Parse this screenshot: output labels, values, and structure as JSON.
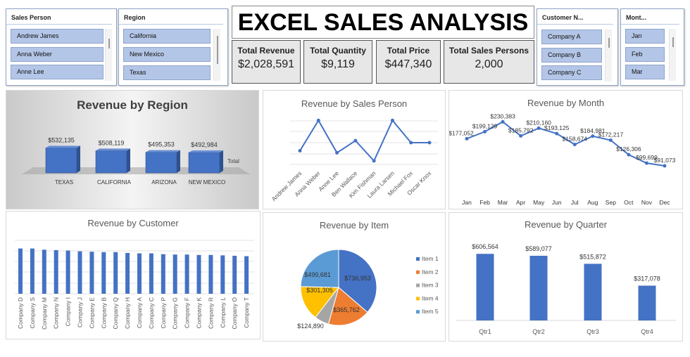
{
  "title": "EXCEL SALES ANALYSIS",
  "slicers": {
    "sales_person": {
      "header": "Sales Person",
      "items": [
        "Andrew James",
        "Anna Weber",
        "Anne Lee"
      ]
    },
    "region": {
      "header": "Region",
      "items": [
        "California",
        "New Mexico",
        "Texas"
      ]
    },
    "customer": {
      "header": "Customer N...",
      "items": [
        "Company A",
        "Company B",
        "Company C"
      ]
    },
    "month": {
      "header": "Mont...",
      "items": [
        "Jan",
        "Feb",
        "Mar"
      ]
    }
  },
  "kpis": [
    {
      "label": "Total Revenue",
      "value": "$2,028,591"
    },
    {
      "label": "Total Quantity",
      "value": "$9,119"
    },
    {
      "label": "Total Price",
      "value": "$447,340"
    },
    {
      "label": "Total Sales Persons",
      "value": "2,000"
    }
  ],
  "colors": {
    "accent": "#4472c4",
    "orange": "#ed7d31",
    "gray": "#a5a5a5",
    "yellow": "#ffc000",
    "lightblue": "#5b9bd5"
  },
  "chart_data": [
    {
      "id": "region",
      "type": "bar",
      "title": "Revenue by Region",
      "categories": [
        "TEXAS",
        "CALIFORNIA",
        "ARIZONA",
        "NEW MEXICO"
      ],
      "values": [
        532135,
        508119,
        495353,
        492984
      ],
      "labels": [
        "$532,135",
        "$508,119",
        "$495,353",
        "$492,984"
      ],
      "series_label": "Total"
    },
    {
      "id": "salesperson",
      "type": "line",
      "title": "Revenue by Sales Person",
      "categories": [
        "Andrew James",
        "Anna Weber",
        "Anne Lee",
        "Ben Wallace",
        "Kim Fishman",
        "Laura Larsen",
        "Michael Fox",
        "Oscar Knox"
      ],
      "values": [
        252000,
        282000,
        250000,
        262000,
        242000,
        282000,
        260000,
        260000
      ]
    },
    {
      "id": "month",
      "type": "line",
      "title": "Revenue by Month",
      "categories": [
        "Jan",
        "Feb",
        "Mar",
        "Apr",
        "May",
        "Jun",
        "Jul",
        "Aug",
        "Sep",
        "Oct",
        "Nov",
        "Dec"
      ],
      "values": [
        177052,
        199129,
        230383,
        185792,
        210160,
        193125,
        158674,
        184981,
        172217,
        126306,
        99699,
        91073
      ],
      "labels": [
        "$177,052",
        "$199,129",
        "$230,383",
        "$185,792",
        "$210,160",
        "$193,125",
        "$158,674",
        "$184,981",
        "$172,217",
        "$126,306",
        "$99,699",
        "$91,073"
      ]
    },
    {
      "id": "customer",
      "type": "bar",
      "title": "Revenue by Customer",
      "categories": [
        "Company D",
        "Company S",
        "Company M",
        "Company N",
        "Company I",
        "Company J",
        "Company E",
        "Company B",
        "Company Q",
        "Company H",
        "Company A",
        "Company C",
        "Company P",
        "Company G",
        "Company F",
        "Company K",
        "Company R",
        "Company L",
        "Company O",
        "Company T"
      ],
      "values": [
        112,
        112,
        109,
        108,
        107,
        105,
        104,
        103,
        103,
        101,
        100,
        100,
        98,
        97,
        97,
        96,
        96,
        95,
        94,
        93
      ],
      "ylim": [
        0,
        120
      ]
    },
    {
      "id": "item",
      "type": "pie",
      "title": "Revenue by Item",
      "categories": [
        "Item 1",
        "Item 2",
        "Item 3",
        "Item 4",
        "Item 5"
      ],
      "values": [
        736953,
        365762,
        124890,
        301305,
        499681
      ],
      "labels": [
        "$736,953",
        "$365,762",
        "$124,890",
        "$301,305",
        "$499,681"
      ]
    },
    {
      "id": "quarter",
      "type": "bar",
      "title": "Revenue by Quarter",
      "categories": [
        "Qtr1",
        "Qtr2",
        "Qtr3",
        "Qtr4"
      ],
      "values": [
        606564,
        589077,
        515872,
        317078
      ],
      "labels": [
        "$606,564",
        "$589,077",
        "$515,872",
        "$317,078"
      ]
    }
  ]
}
